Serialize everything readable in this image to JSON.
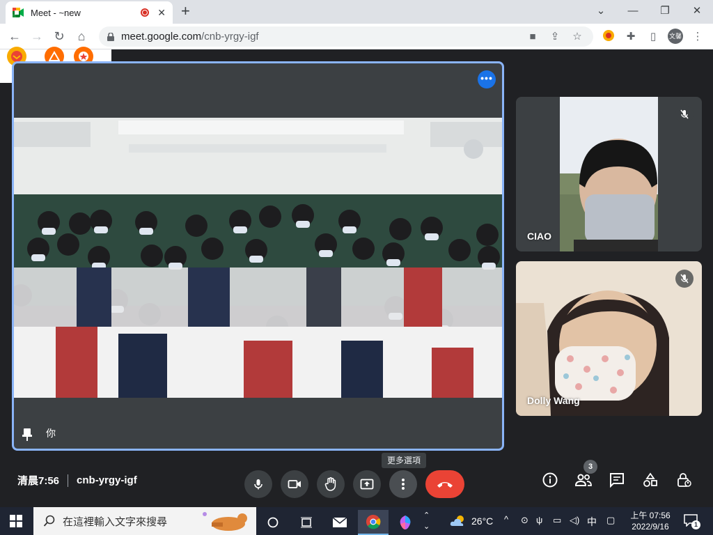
{
  "browser": {
    "tab_title": "Meet - ~new",
    "tab_close": "✕",
    "new_tab": "+",
    "url_host": "meet.google.com",
    "url_path": "/cnb-yrgy-igf",
    "profile_label": "文馨"
  },
  "meeting": {
    "self_name": "你",
    "time": "清晨7:56",
    "code": "cnb-yrgy-igf",
    "tooltip": "更多選項",
    "people_count": "3"
  },
  "participants": [
    {
      "name": "CIAO",
      "mic_muted": true
    },
    {
      "name": "Dolly Wang",
      "mic_muted": true
    }
  ],
  "taskbar": {
    "search_placeholder": "在這裡輸入文字來搜尋",
    "weather": "26°C",
    "ime": "中",
    "clock_time": "上午 07:56",
    "clock_date": "2022/9/16",
    "notification_count": "1"
  },
  "colors": {
    "meet_bg": "#202124",
    "active_border": "#8ab4f8",
    "end_call": "#ea4335",
    "dots_button": "#1a73e8"
  }
}
